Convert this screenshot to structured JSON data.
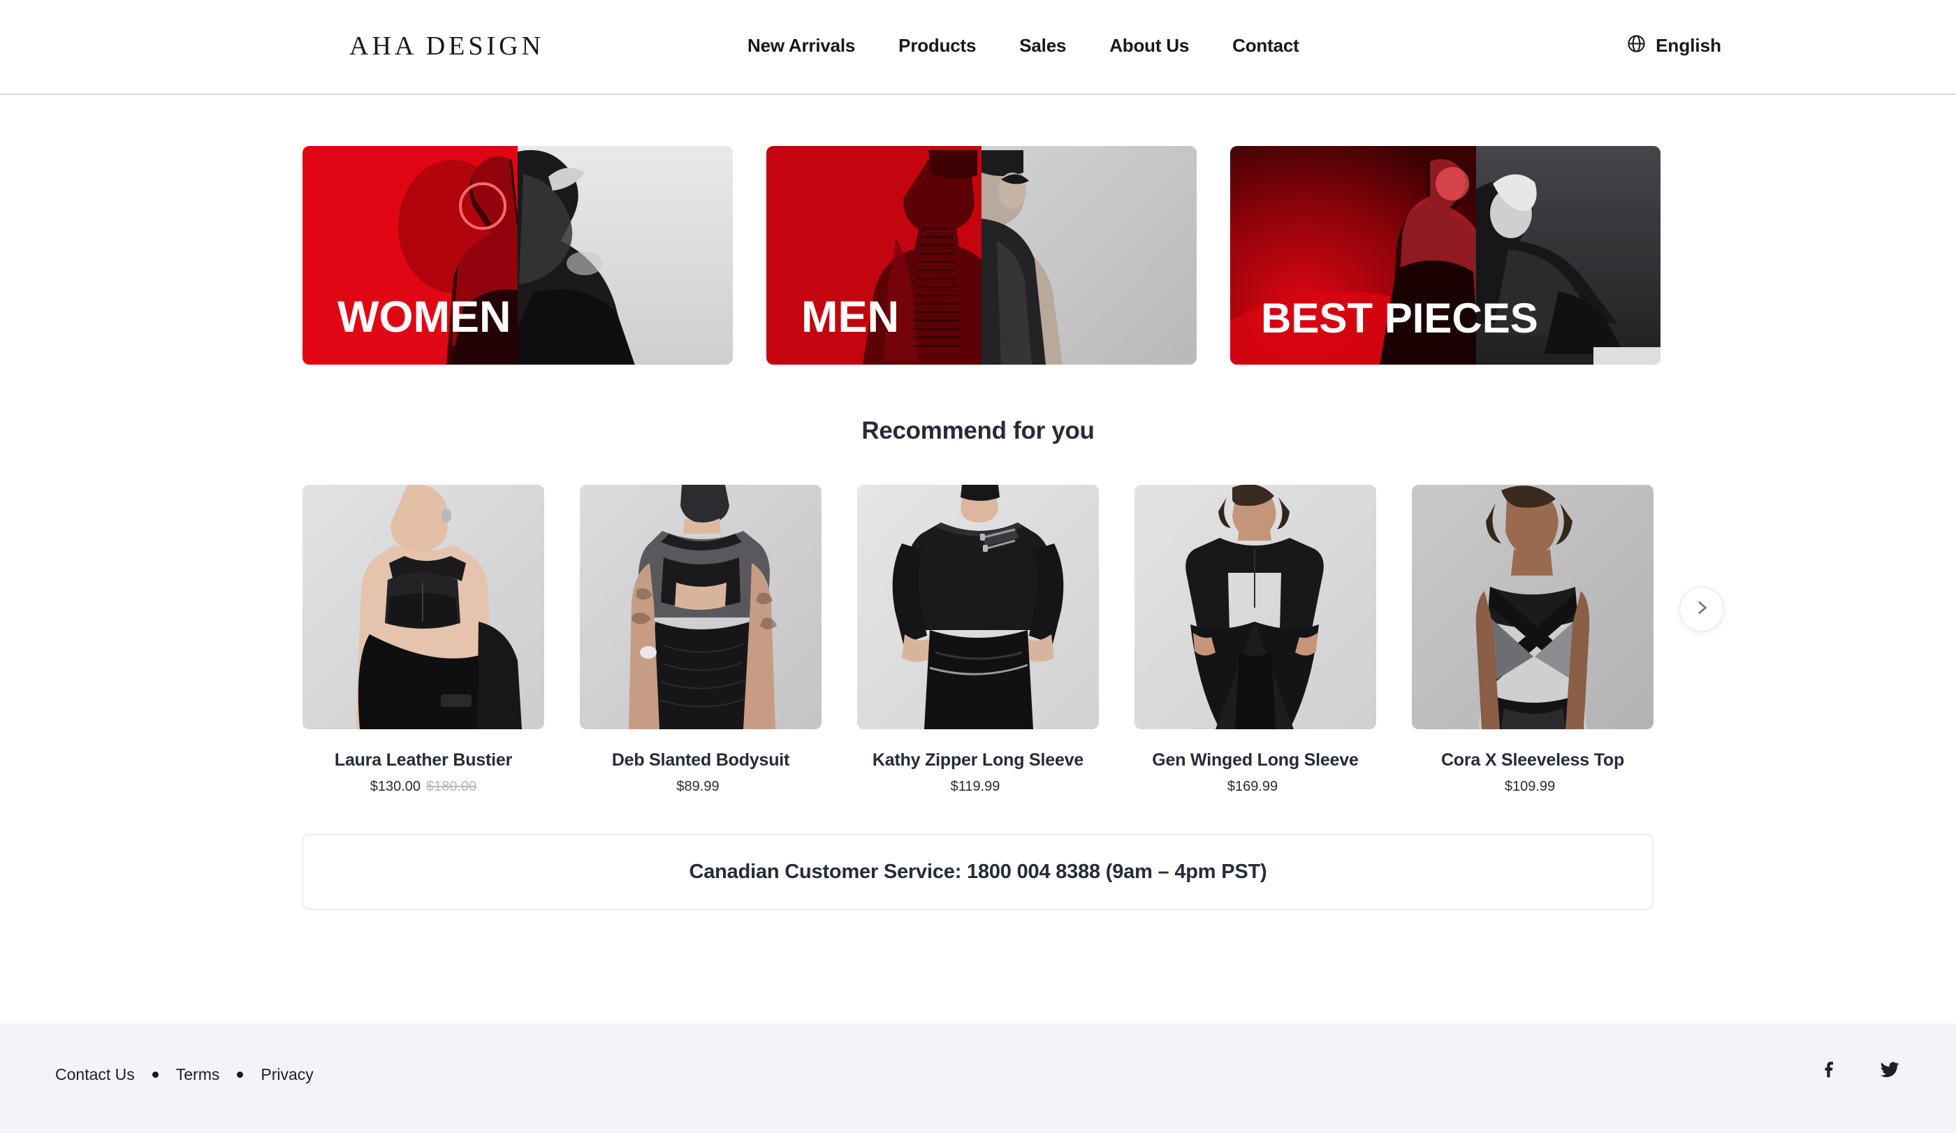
{
  "brand": {
    "logo_text": "AHA DESIGN",
    "accent_red": "#e00613",
    "text_dark": "#262b38",
    "footer_bg": "#f3f4f7"
  },
  "header": {
    "nav": [
      {
        "label": "New Arrivals",
        "name": "nav-new-arrivals"
      },
      {
        "label": "Products",
        "name": "nav-products"
      },
      {
        "label": "Sales",
        "name": "nav-sales"
      },
      {
        "label": "About Us",
        "name": "nav-about-us"
      },
      {
        "label": "Contact",
        "name": "nav-contact"
      }
    ],
    "language": {
      "icon": "globe-icon",
      "label": "English"
    }
  },
  "banners": [
    {
      "label": "WOMEN",
      "name": "banner-women"
    },
    {
      "label": "MEN",
      "name": "banner-men"
    },
    {
      "label": "BEST PIECES",
      "name": "banner-best-pieces"
    }
  ],
  "recommend": {
    "title": "Recommend for you",
    "next_icon": "chevron-right-icon",
    "products": [
      {
        "name": "Laura Leather Bustier",
        "price": "$130.00",
        "old_price": "$180.00"
      },
      {
        "name": "Deb Slanted Bodysuit",
        "price": "$89.99",
        "old_price": ""
      },
      {
        "name": "Kathy Zipper Long Sleeve",
        "price": "$119.99",
        "old_price": ""
      },
      {
        "name": "Gen Winged Long Sleeve",
        "price": "$169.99",
        "old_price": ""
      },
      {
        "name": "Cora X Sleeveless Top",
        "price": "$109.99",
        "old_price": ""
      }
    ]
  },
  "service": {
    "text": "Canadian Customer Service: 1800 004 8388 (9am – 4pm PST)"
  },
  "footer": {
    "links": [
      {
        "label": "Contact Us",
        "name": "footer-link-contact-us"
      },
      {
        "label": "Terms",
        "name": "footer-link-terms"
      },
      {
        "label": "Privacy",
        "name": "footer-link-privacy"
      }
    ],
    "social": [
      {
        "name": "facebook-icon"
      },
      {
        "name": "twitter-icon"
      }
    ]
  }
}
